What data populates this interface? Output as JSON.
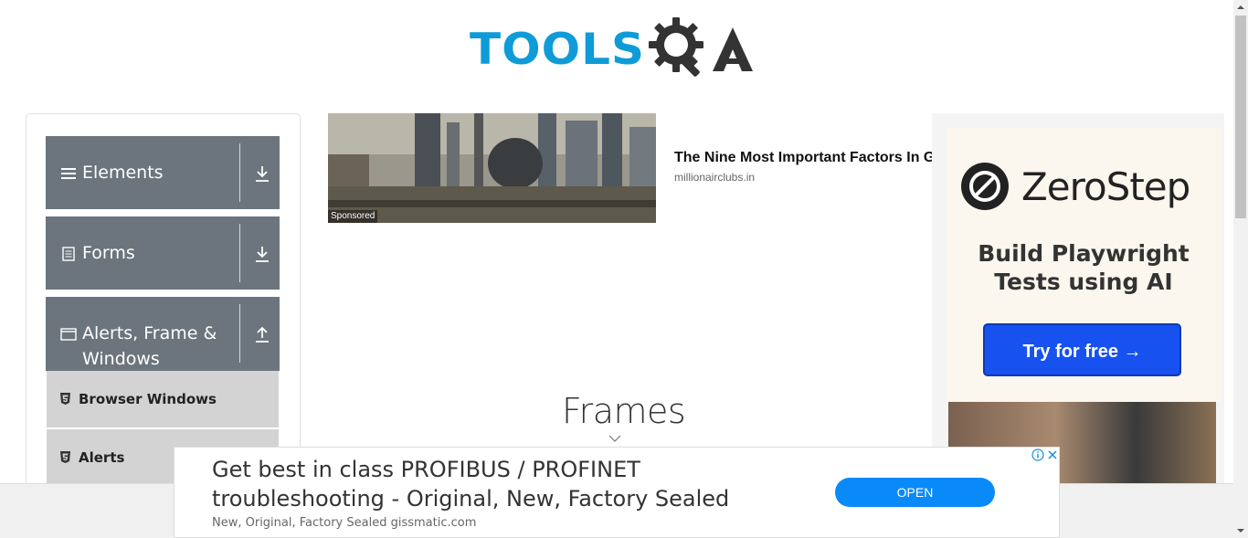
{
  "header": {
    "logo_text": "TOOLS",
    "logo_suffix": "QA"
  },
  "sidebar": {
    "groups": [
      {
        "label": "Elements"
      },
      {
        "label": "Forms"
      },
      {
        "label": "Alerts, Frame & Windows"
      }
    ],
    "items": [
      {
        "label": "Browser Windows"
      },
      {
        "label": "Alerts"
      }
    ]
  },
  "ad_top": {
    "sponsored": "Sponsored",
    "headline": "The Nine Most Important Factors In G",
    "domain": "millionairclubs.in"
  },
  "main": {
    "title": "Frames"
  },
  "ad_right": {
    "brand": "ZeroStep",
    "tagline": "Build Playwright Tests using AI",
    "cta": "Try for free →"
  },
  "ad_bottom": {
    "headline": "Get best in class PROFIBUS / PROFINET troubleshooting - Original, New, Factory Sealed",
    "subline": "New, Original, Factory Sealed gissmatic.com",
    "cta": "OPEN"
  },
  "colors": {
    "logo_blue": "#0f9bd7",
    "sidebar_header": "#6c757d",
    "sidebar_item": "#d3d3d3",
    "cta_blue": "#1751f0",
    "open_blue": "#0a8af8"
  },
  "icons": {
    "elements": "hamburger-icon",
    "forms": "document-icon",
    "alerts": "window-icon",
    "collapse": "download-arrow-icon",
    "expand": "upload-arrow-icon",
    "item": "html5-icon"
  }
}
